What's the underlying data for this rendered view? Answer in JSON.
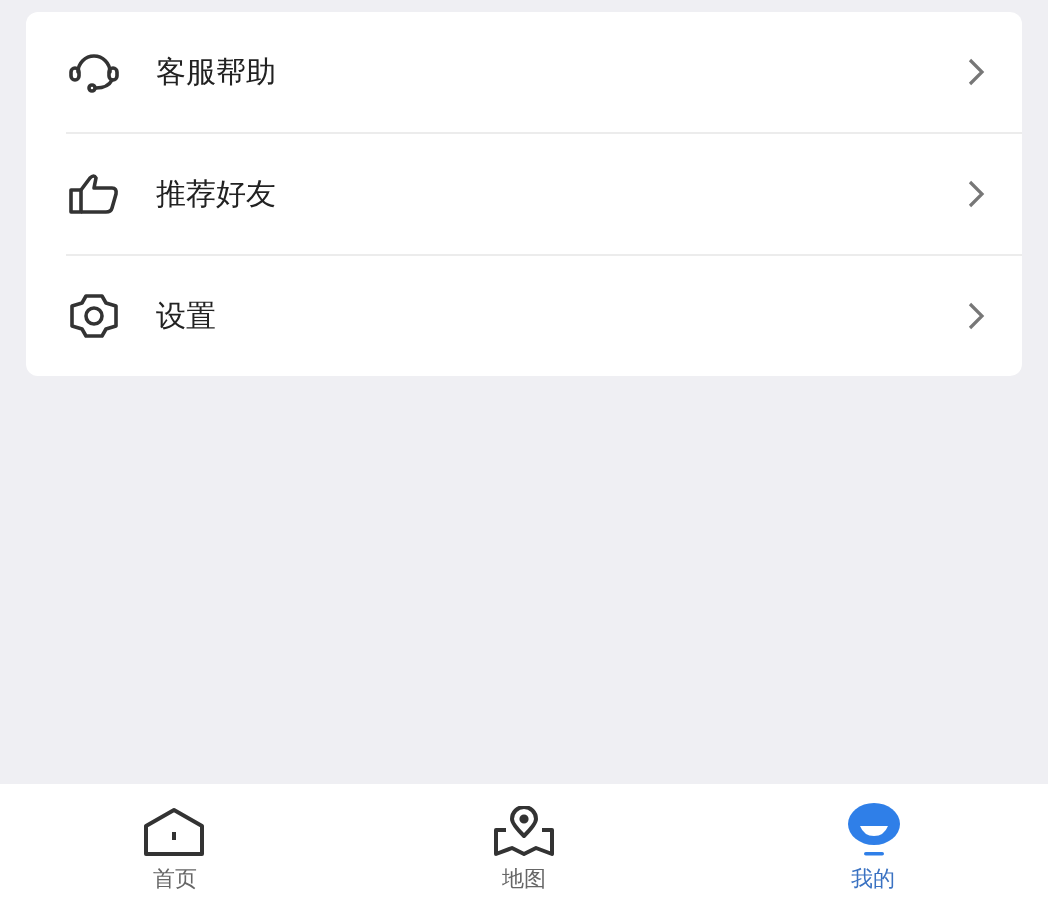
{
  "menu": [
    {
      "label": "客服帮助"
    },
    {
      "label": "推荐好友"
    },
    {
      "label": "设置"
    }
  ],
  "tabs": [
    {
      "label": "首页",
      "selected": false
    },
    {
      "label": "地图",
      "selected": false
    },
    {
      "label": "我的",
      "selected": true
    }
  ]
}
